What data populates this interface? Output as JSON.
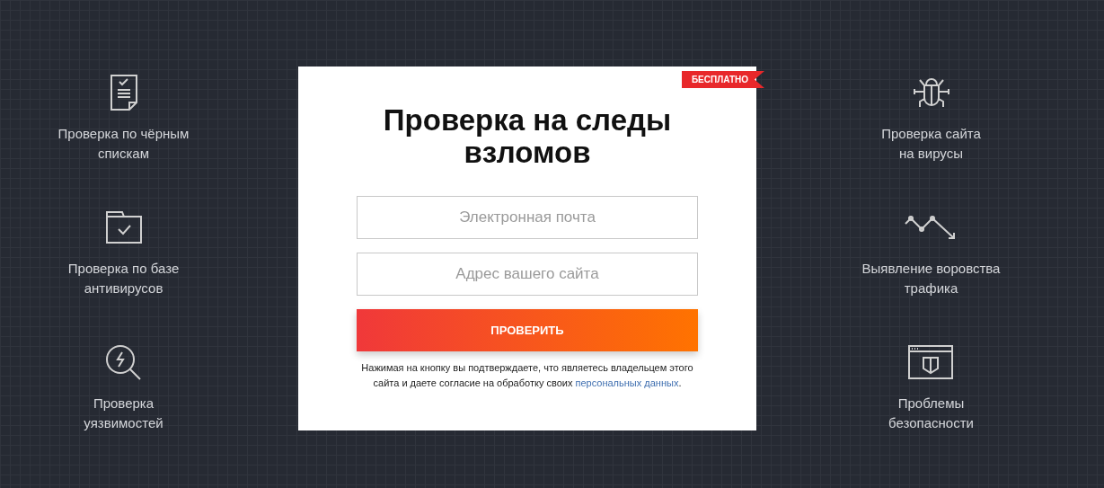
{
  "left_features": [
    {
      "kind": "document",
      "lines": [
        "Проверка по чёрным",
        "спискам"
      ]
    },
    {
      "kind": "folder",
      "lines": [
        "Проверка по базе",
        "антивирусов"
      ]
    },
    {
      "kind": "magnifier",
      "lines": [
        "Проверка",
        "уязвимостей"
      ]
    }
  ],
  "form": {
    "badge": "БЕСПЛАТНО",
    "title": "Проверка на следы взломов",
    "fields": [
      {
        "placeholder": "Электронная почта"
      },
      {
        "placeholder": "Адрес вашего сайта"
      }
    ],
    "button": "ПРОВЕРИТЬ",
    "consent": {
      "text": "Нажимая на кнопку вы подтверждаете, что являетесь владельцем этого сайта и даете согласие на обработку своих ",
      "link": "персональных данных",
      "end": "."
    }
  },
  "right_features": [
    {
      "kind": "bug",
      "lines": [
        "Проверка сайта",
        "на вирусы"
      ]
    },
    {
      "kind": "trend",
      "lines": [
        "Выявление воровства",
        "трафика"
      ]
    },
    {
      "kind": "shield",
      "lines": [
        "Проблемы",
        "безопасности"
      ]
    }
  ]
}
